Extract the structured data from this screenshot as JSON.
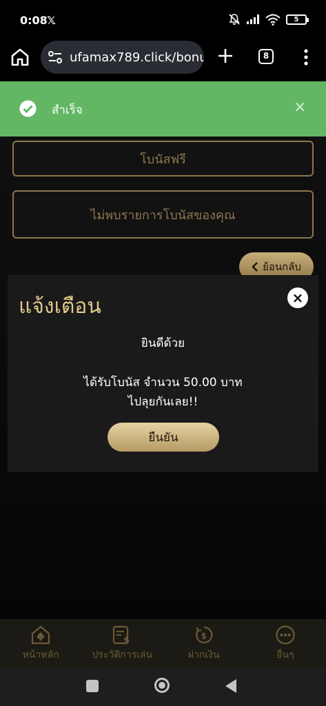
{
  "status_bar": {
    "time": "0:08",
    "x_logo": "𝕏",
    "battery": "5"
  },
  "browser": {
    "url": "ufamax789.click/bonu",
    "tab_count": "8"
  },
  "toast": {
    "message": "สำเร็จ",
    "close_glyph": "×",
    "color": "#63b764"
  },
  "page": {
    "free_bonus_label": "โบนัสฟรี",
    "no_bonus_text": "ไม่พบรายการโบนัสของคุณ",
    "back_label": "ย้อนกลับ"
  },
  "dialog": {
    "title": "แจ้งเตือน",
    "close_glyph": "×",
    "heading": "ยินดีด้วย",
    "message_line1": "ได้รับโบนัส จำนวน 50.00 บาท",
    "message_line2": "ไปลุยกันเลย!!",
    "confirm_label": "ยืนยัน"
  },
  "bottom_nav": {
    "items": [
      {
        "label": "หน้าหลัก",
        "icon": "home-spade-icon"
      },
      {
        "label": "ประวัติการเล่น",
        "icon": "history-icon"
      },
      {
        "label": "ฝากเงิน",
        "icon": "deposit-icon"
      },
      {
        "label": "อื่นๆ",
        "icon": "more-icon"
      }
    ]
  },
  "colors": {
    "gold": "#8e7750",
    "gold_title": "#e1c88c",
    "nav_bg": "#1c1a14"
  }
}
